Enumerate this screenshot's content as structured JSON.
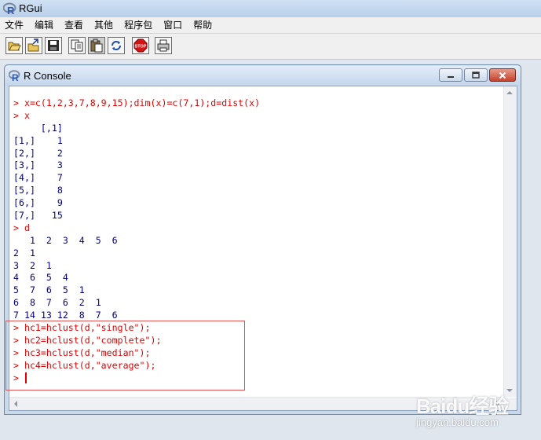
{
  "app": {
    "title": "RGui"
  },
  "menu": [
    {
      "label": "文件"
    },
    {
      "label": "编辑"
    },
    {
      "label": "查看"
    },
    {
      "label": "其他"
    },
    {
      "label": "程序包"
    },
    {
      "label": "窗口"
    },
    {
      "label": "帮助"
    }
  ],
  "toolbar": {
    "buttons": [
      {
        "icon": "open-script-icon"
      },
      {
        "icon": "load-workspace-icon"
      },
      {
        "icon": "save-workspace-icon"
      },
      {
        "icon": "copy-icon"
      },
      {
        "icon": "paste-icon"
      },
      {
        "icon": "copy-paste-icon"
      },
      {
        "icon": "stop-icon",
        "text": "STOP"
      },
      {
        "icon": "print-icon"
      }
    ]
  },
  "console": {
    "title": "R Console",
    "lines": [
      {
        "type": "cmd",
        "text": "> x=c(1,2,3,7,8,9,15);dim(x)=c(7,1);d=dist(x)"
      },
      {
        "type": "cmd",
        "text": "> x"
      },
      {
        "type": "out",
        "text": "     [,1]"
      },
      {
        "type": "out",
        "text": "[1,]    1"
      },
      {
        "type": "out",
        "text": "[2,]    2"
      },
      {
        "type": "out",
        "text": "[3,]    3"
      },
      {
        "type": "out",
        "text": "[4,]    7"
      },
      {
        "type": "out",
        "text": "[5,]    8"
      },
      {
        "type": "out",
        "text": "[6,]    9"
      },
      {
        "type": "out",
        "text": "[7,]   15"
      },
      {
        "type": "cmd",
        "text": "> d"
      },
      {
        "type": "out",
        "text": "   1  2  3  4  5  6"
      },
      {
        "type": "out",
        "text": "2  1"
      },
      {
        "type": "out",
        "text": "3  2  1"
      },
      {
        "type": "out",
        "text": "4  6  5  4"
      },
      {
        "type": "out",
        "text": "5  7  6  5  1"
      },
      {
        "type": "out",
        "text": "6  8  7  6  2  1"
      },
      {
        "type": "out",
        "text": "7 14 13 12  8  7  6"
      },
      {
        "type": "cmd",
        "text": "> hc1=hclust(d,\"single\");"
      },
      {
        "type": "cmd",
        "text": "> hc2=hclust(d,\"complete\");"
      },
      {
        "type": "cmd",
        "text": "> hc3=hclust(d,\"median\");"
      },
      {
        "type": "cmd",
        "text": "> hc4=hclust(d,\"average\");"
      },
      {
        "type": "prompt",
        "text": "> "
      }
    ]
  },
  "watermark": {
    "brand": "Baidu经验",
    "url": "jingyan.baidu.com"
  },
  "colors": {
    "command": "#e00000",
    "output": "#000080",
    "highlight": "#e05050"
  }
}
